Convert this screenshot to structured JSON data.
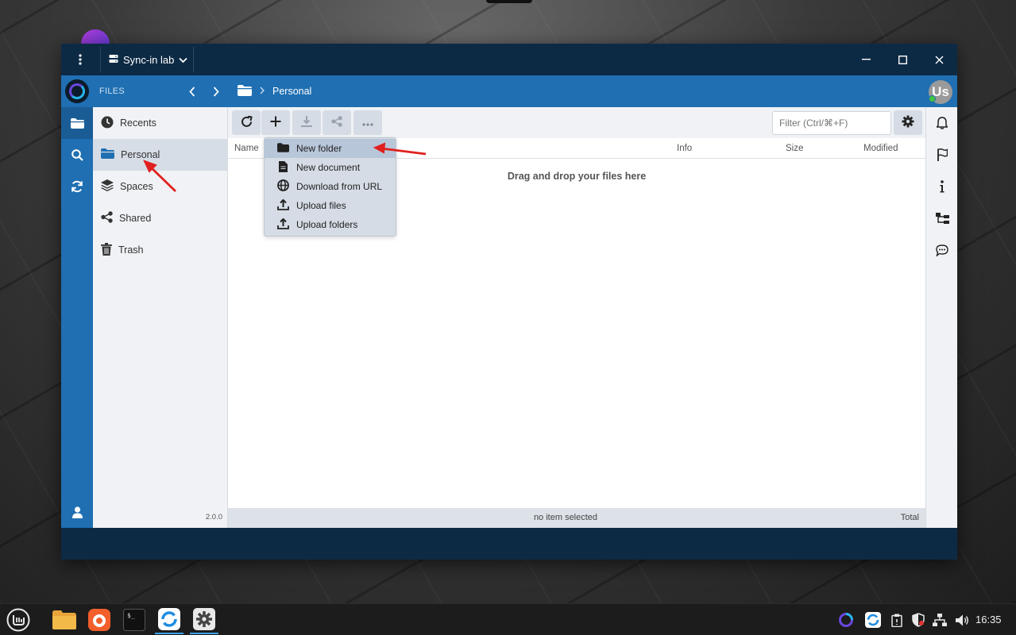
{
  "window": {
    "server_name": "Sync-in lab",
    "menu_icon": "kebab-menu-icon",
    "controls": [
      "minimize-icon",
      "maximize-icon",
      "close-icon"
    ]
  },
  "header": {
    "section_label": "FILES",
    "breadcrumb": [
      "Personal"
    ],
    "avatar_text": "Us"
  },
  "rail": {
    "items": [
      "folder-icon",
      "search-icon",
      "sync-icon"
    ],
    "bottom": "user-icon"
  },
  "sidebar": {
    "items": [
      {
        "label": "Recents",
        "icon": "clock-icon"
      },
      {
        "label": "Personal",
        "icon": "folder-icon",
        "active": true
      },
      {
        "label": "Spaces",
        "icon": "layers-icon"
      },
      {
        "label": "Shared",
        "icon": "share-icon"
      },
      {
        "label": "Trash",
        "icon": "trash-icon"
      }
    ],
    "version": "2.0.0"
  },
  "toolbar": {
    "buttons": [
      "refresh-icon",
      "plus-icon",
      "download-icon",
      "share-icon",
      "more-icon"
    ],
    "filter_placeholder": "Filter (Ctrl/⌘+F)"
  },
  "columns": [
    "Name",
    "Info",
    "Size",
    "Modified"
  ],
  "dropzone_text": "Drag and drop your files here",
  "menu": {
    "items": [
      {
        "label": "New folder",
        "icon": "folder-icon",
        "highlighted": true
      },
      {
        "label": "New document",
        "icon": "document-icon"
      },
      {
        "label": "Download from URL",
        "icon": "globe-icon"
      },
      {
        "label": "Upload files",
        "icon": "upload-icon"
      },
      {
        "label": "Upload folders",
        "icon": "upload-icon"
      }
    ]
  },
  "status": {
    "selection": "no item selected",
    "total": "Total"
  },
  "right_rail": [
    "bell-icon",
    "flag-icon",
    "info-icon",
    "tree-icon",
    "chat-icon"
  ],
  "taskbar": {
    "clock": "16:35"
  },
  "colors": {
    "header_blue": "#1f6fb2",
    "titlebar_navy": "#0d2a45",
    "annotation_red": "#e0201e"
  }
}
